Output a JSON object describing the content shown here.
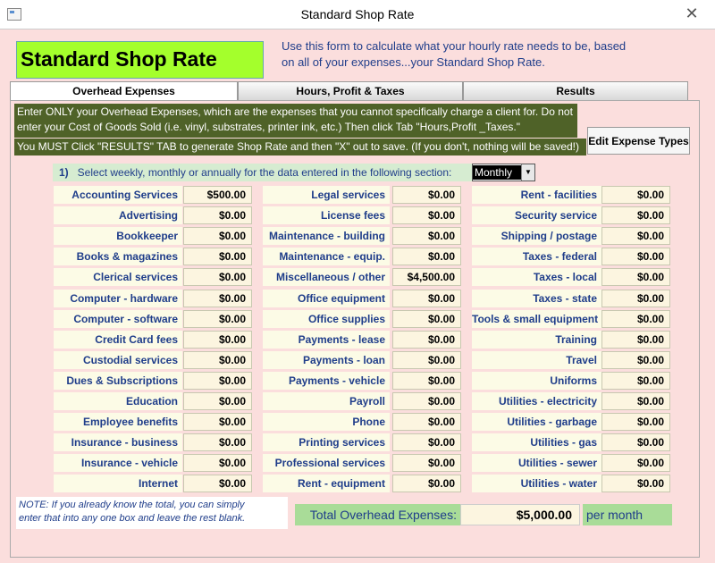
{
  "window": {
    "title": "Standard Shop Rate",
    "close_glyph": "✕"
  },
  "header": {
    "title": "Standard Shop Rate",
    "intro_line1": "Use this form to calculate what your hourly rate needs to be, based",
    "intro_line2": "on all of your expenses...your Standard Shop Rate."
  },
  "tabs": [
    "Overhead Expenses",
    "Hours, Profit & Taxes",
    "Results"
  ],
  "instructions": {
    "line1": "Enter ONLY your Overhead Expenses, which are the expenses that you cannot specifically charge a client for.  Do not",
    "line2": "enter your Cost of Goods Sold (i.e. vinyl, substrates, printer ink, etc.)  Then click Tab \"Hours,Profit _Taxes.\"",
    "warning": "You MUST Click \"RESULTS\" TAB to generate Shop Rate and then \"X\" out to save. (If you don't, nothing will be saved!)"
  },
  "edit_button": "Edit Expense Types",
  "period": {
    "number": "1)",
    "prompt": "Select weekly, monthly or annually for the data entered in the following section:",
    "selected": "Monthly"
  },
  "columns": [
    [
      {
        "label": "Accounting Services",
        "value": "$500.00"
      },
      {
        "label": "Advertising",
        "value": "$0.00"
      },
      {
        "label": "Bookkeeper",
        "value": "$0.00"
      },
      {
        "label": "Books & magazines",
        "value": "$0.00"
      },
      {
        "label": "Clerical services",
        "value": "$0.00"
      },
      {
        "label": "Computer - hardware",
        "value": "$0.00"
      },
      {
        "label": "Computer - software",
        "value": "$0.00"
      },
      {
        "label": "Credit Card fees",
        "value": "$0.00"
      },
      {
        "label": "Custodial services",
        "value": "$0.00"
      },
      {
        "label": "Dues & Subscriptions",
        "value": "$0.00"
      },
      {
        "label": "Education",
        "value": "$0.00"
      },
      {
        "label": "Employee benefits",
        "value": "$0.00"
      },
      {
        "label": "Insurance - business",
        "value": "$0.00"
      },
      {
        "label": "Insurance - vehicle",
        "value": "$0.00"
      },
      {
        "label": "Internet",
        "value": "$0.00"
      }
    ],
    [
      {
        "label": "Legal services",
        "value": "$0.00"
      },
      {
        "label": "License fees",
        "value": "$0.00"
      },
      {
        "label": "Maintenance - building",
        "value": "$0.00"
      },
      {
        "label": "Maintenance - equip.",
        "value": "$0.00"
      },
      {
        "label": "Miscellaneous / other",
        "value": "$4,500.00"
      },
      {
        "label": "Office equipment",
        "value": "$0.00"
      },
      {
        "label": "Office supplies",
        "value": "$0.00"
      },
      {
        "label": "Payments - lease",
        "value": "$0.00"
      },
      {
        "label": "Payments - loan",
        "value": "$0.00"
      },
      {
        "label": "Payments - vehicle",
        "value": "$0.00"
      },
      {
        "label": "Payroll",
        "value": "$0.00"
      },
      {
        "label": "Phone",
        "value": "$0.00"
      },
      {
        "label": "Printing services",
        "value": "$0.00"
      },
      {
        "label": "Professional services",
        "value": "$0.00"
      },
      {
        "label": "Rent - equipment",
        "value": "$0.00"
      }
    ],
    [
      {
        "label": "Rent - facilities",
        "value": "$0.00"
      },
      {
        "label": "Security service",
        "value": "$0.00"
      },
      {
        "label": "Shipping / postage",
        "value": "$0.00"
      },
      {
        "label": "Taxes - federal",
        "value": "$0.00"
      },
      {
        "label": "Taxes - local",
        "value": "$0.00"
      },
      {
        "label": "Taxes - state",
        "value": "$0.00"
      },
      {
        "label": "Tools & small equipment",
        "value": "$0.00"
      },
      {
        "label": "Training",
        "value": "$0.00"
      },
      {
        "label": "Travel",
        "value": "$0.00"
      },
      {
        "label": "Uniforms",
        "value": "$0.00"
      },
      {
        "label": "Utilities - electricity",
        "value": "$0.00"
      },
      {
        "label": "Utilities - garbage",
        "value": "$0.00"
      },
      {
        "label": "Utilities - gas",
        "value": "$0.00"
      },
      {
        "label": "Utilities - sewer",
        "value": "$0.00"
      },
      {
        "label": "Utilities - water",
        "value": "$0.00"
      }
    ]
  ],
  "note": {
    "line1": "NOTE: If you already know the total, you can simply",
    "line2": "enter that into any one box and leave the rest blank."
  },
  "total": {
    "label": "Total Overhead Expenses:",
    "value": "$5,000.00",
    "unit": "per month"
  }
}
